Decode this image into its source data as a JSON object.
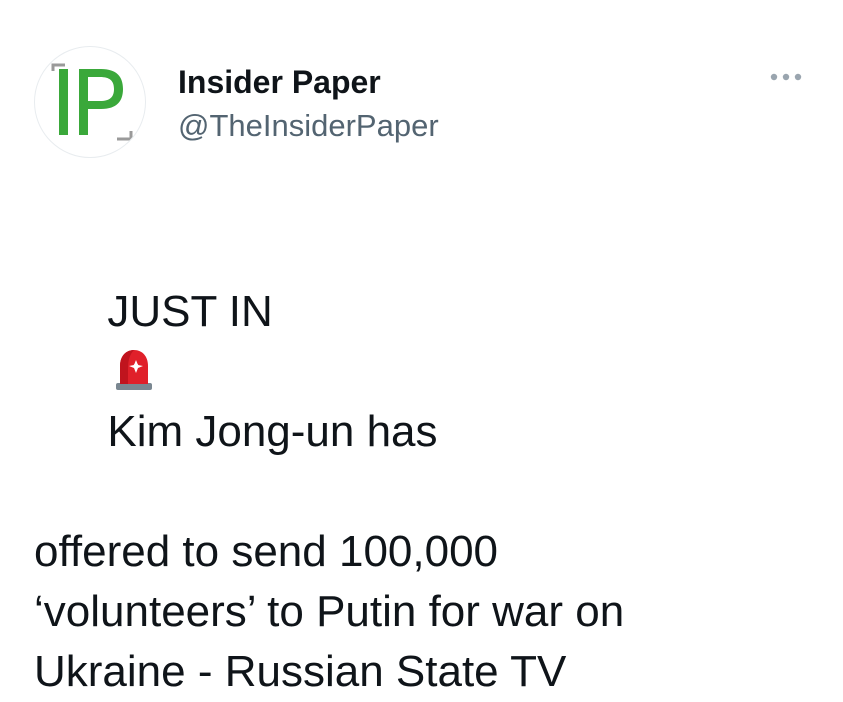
{
  "author": {
    "avatar_text": "IP",
    "display_name": "Insider Paper",
    "handle": "@TheInsiderPaper"
  },
  "icons": {
    "more": "more-options-icon",
    "siren": "police-siren-emoji-icon"
  },
  "colors": {
    "logo_green": "#3aa83a",
    "logo_gray": "#8a8a8a",
    "handle_gray": "#536471",
    "text": "#0f1419"
  },
  "tweet": {
    "part_before_emoji": "JUST IN",
    "emoji_name": "police car light",
    "part_after_emoji": "Kim Jong-un has",
    "line2": "offered to send 100,000",
    "line3": "‘volunteers’ to Putin for war on",
    "line4": "Ukraine - Russian State TV"
  }
}
